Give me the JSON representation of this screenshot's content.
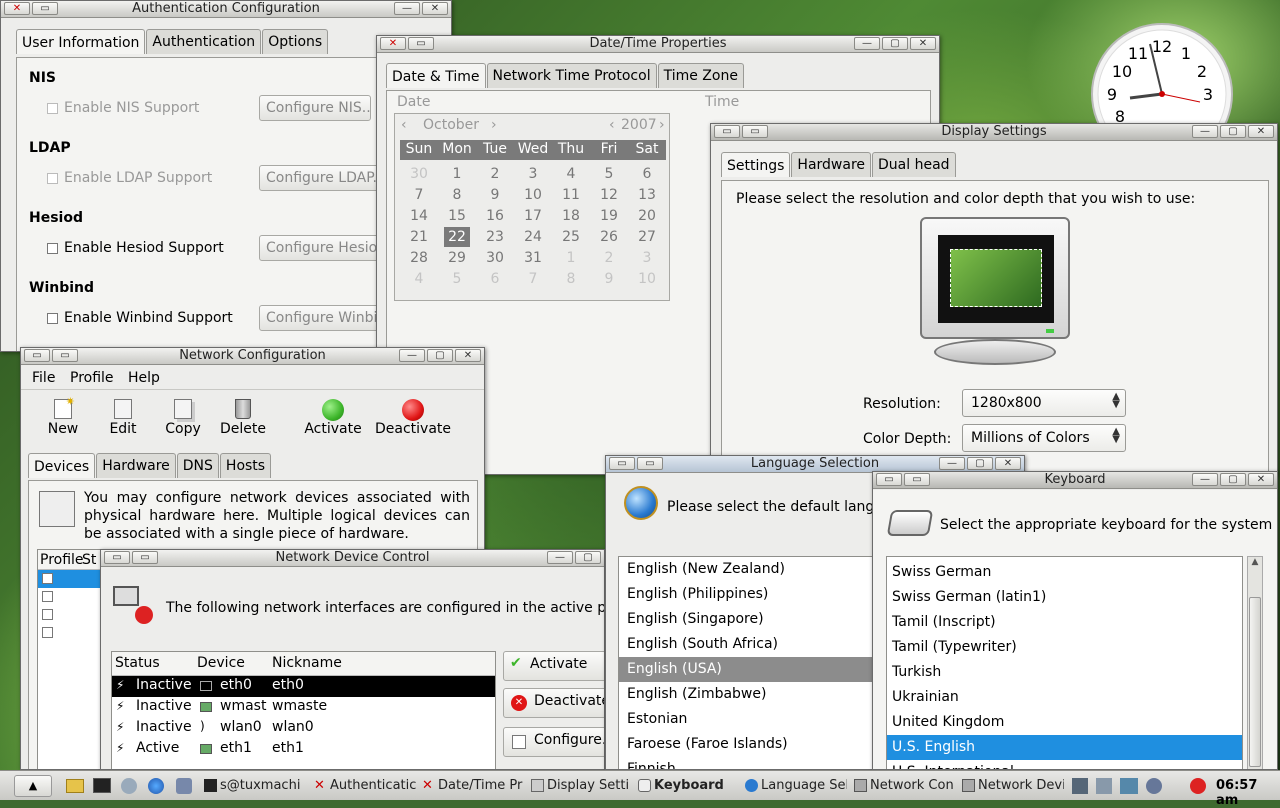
{
  "auth": {
    "title": "Authentication Configuration",
    "tabs": [
      "User Information",
      "Authentication",
      "Options"
    ],
    "sections": [
      {
        "heading": "NIS",
        "checkbox": "Enable NIS Support",
        "button": "Configure NIS..."
      },
      {
        "heading": "LDAP",
        "checkbox": "Enable LDAP Support",
        "button": "Configure LDAP..."
      },
      {
        "heading": "Hesiod",
        "checkbox": "Enable Hesiod Support",
        "button": "Configure Hesiod..."
      },
      {
        "heading": "Winbind",
        "checkbox": "Enable Winbind Support",
        "button": "Configure Winbind..."
      }
    ]
  },
  "datetime": {
    "title": "Date/Time Properties",
    "tabs": [
      "Date & Time",
      "Network Time Protocol",
      "Time Zone"
    ],
    "date_label": "Date",
    "time_label": "Time",
    "month": "October",
    "year": "2007",
    "weekdays": [
      "Sun",
      "Mon",
      "Tue",
      "Wed",
      "Thu",
      "Fri",
      "Sat"
    ],
    "weeks": [
      [
        "30",
        "1",
        "2",
        "3",
        "4",
        "5",
        "6"
      ],
      [
        "7",
        "8",
        "9",
        "10",
        "11",
        "12",
        "13"
      ],
      [
        "14",
        "15",
        "16",
        "17",
        "18",
        "19",
        "20"
      ],
      [
        "21",
        "22",
        "23",
        "24",
        "25",
        "26",
        "27"
      ],
      [
        "28",
        "29",
        "30",
        "31",
        "1",
        "2",
        "3"
      ],
      [
        "4",
        "5",
        "6",
        "7",
        "8",
        "9",
        "10"
      ]
    ],
    "selected_day": "22"
  },
  "display": {
    "title": "Display Settings",
    "tabs": [
      "Settings",
      "Hardware",
      "Dual head"
    ],
    "prompt": "Please select the resolution and color depth that you wish to use:",
    "resolution_label": "Resolution:",
    "resolution_value": "1280x800",
    "depth_label": "Color Depth:",
    "depth_value": "Millions of Colors"
  },
  "network": {
    "title": "Network Configuration",
    "menu": [
      "File",
      "Profile",
      "Help"
    ],
    "toolbar": [
      "New",
      "Edit",
      "Copy",
      "Delete",
      "Activate",
      "Deactivate"
    ],
    "tabs": [
      "Devices",
      "Hardware",
      "DNS",
      "Hosts"
    ],
    "info": "You may configure network devices associated with physical hardware here.  Multiple logical devices can be associated with a single piece of hardware.",
    "cols": [
      "Profile",
      "St"
    ]
  },
  "netdev": {
    "title": "Network Device Control",
    "message": "The following network interfaces are configured in the active profile:",
    "cols": [
      "Status",
      "Device",
      "Nickname"
    ],
    "rows": [
      {
        "status": "Inactive",
        "device": "eth0",
        "nickname": "eth0"
      },
      {
        "status": "Inactive",
        "device": "wmast",
        "nickname": "wmaste"
      },
      {
        "status": "Inactive",
        "device": "wlan0",
        "nickname": "wlan0"
      },
      {
        "status": "Active",
        "device": "eth1",
        "nickname": "eth1"
      }
    ],
    "buttons": [
      "Activate",
      "Deactivate",
      "Configure..."
    ]
  },
  "language": {
    "title": "Language Selection",
    "prompt": "Please select the default language",
    "items": [
      "English (New Zealand)",
      "English (Philippines)",
      "English (Singapore)",
      "English (South Africa)",
      "English (USA)",
      "English (Zimbabwe)",
      "Estonian",
      "Faroese (Faroe Islands)",
      "Finnish"
    ],
    "selected": "English (USA)"
  },
  "keyboard": {
    "title": "Keyboard",
    "prompt": "Select the appropriate keyboard for the system",
    "items": [
      "Swiss German",
      "Swiss German (latin1)",
      "Tamil (Inscript)",
      "Tamil (Typewriter)",
      "Turkish",
      "Ukrainian",
      "United Kingdom",
      "U.S. English",
      "U.S. International"
    ],
    "selected": "U.S. English"
  },
  "clock": {
    "numerals": [
      "12",
      "1",
      "2",
      "3",
      "9",
      "10",
      "11",
      "8"
    ]
  },
  "taskbar": {
    "tasks": [
      "s@tuxmachi",
      "Authenticatic",
      "Date/Time Pr",
      "Display Settir",
      "Keyboard",
      "Language Sel",
      "Network Con",
      "Network Devi"
    ],
    "time": "06:57 am"
  },
  "colors": {
    "selection_blue": "#1f8fe0",
    "selection_grey": "#8c8c8c",
    "activate_green": "#3db52a",
    "deactivate_red": "#e01515"
  }
}
